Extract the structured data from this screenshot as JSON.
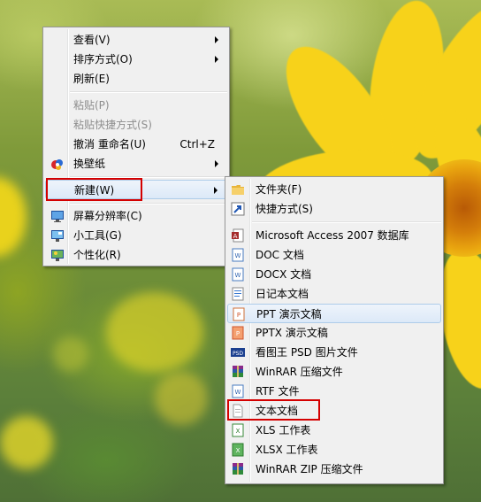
{
  "desktop_menu": {
    "items": [
      {
        "label": "查看(V)",
        "submenu": true
      },
      {
        "label": "排序方式(O)",
        "submenu": true
      },
      {
        "label": "刷新(E)"
      },
      {
        "label": "粘贴(P)",
        "disabled": true
      },
      {
        "label": "粘贴快捷方式(S)",
        "disabled": true
      },
      {
        "label": "撤消 重命名(U)",
        "shortcut": "Ctrl+Z"
      },
      {
        "label": "换壁纸",
        "submenu": true,
        "icon": "wallpaper-icon"
      },
      {
        "label": "新建(W)",
        "submenu": true,
        "highlighted": true
      },
      {
        "label": "屏幕分辨率(C)",
        "icon": "display-icon"
      },
      {
        "label": "小工具(G)",
        "icon": "gadgets-icon"
      },
      {
        "label": "个性化(R)",
        "icon": "personalize-icon"
      }
    ]
  },
  "new_submenu": {
    "items": [
      {
        "label": "文件夹(F)",
        "icon": "folder-icon"
      },
      {
        "label": "快捷方式(S)",
        "icon": "shortcut-icon"
      },
      {
        "label": "Microsoft Access 2007 数据库",
        "icon": "access-db-icon"
      },
      {
        "label": "DOC 文档",
        "icon": "doc-icon"
      },
      {
        "label": "DOCX 文档",
        "icon": "docx-icon"
      },
      {
        "label": "日记本文档",
        "icon": "journal-icon"
      },
      {
        "label": "PPT 演示文稿",
        "icon": "ppt-icon",
        "hover": true
      },
      {
        "label": "PPTX 演示文稿",
        "icon": "pptx-icon"
      },
      {
        "label": "看图王 PSD 图片文件",
        "icon": "psd-icon"
      },
      {
        "label": "WinRAR 压缩文件",
        "icon": "winrar-icon"
      },
      {
        "label": "RTF 文件",
        "icon": "rtf-icon"
      },
      {
        "label": "文本文档",
        "icon": "text-document-icon",
        "highlighted": true
      },
      {
        "label": "XLS 工作表",
        "icon": "xls-icon"
      },
      {
        "label": "XLSX 工作表",
        "icon": "xlsx-icon"
      },
      {
        "label": "WinRAR ZIP 压缩文件",
        "icon": "winrar-zip-icon"
      }
    ]
  },
  "colors": {
    "menu_bg": "#f0f0f0",
    "menu_border": "#979797",
    "highlight_red": "#d40000",
    "disabled_text": "#8d8d8d",
    "flower_yellow": "#f7d21a"
  }
}
